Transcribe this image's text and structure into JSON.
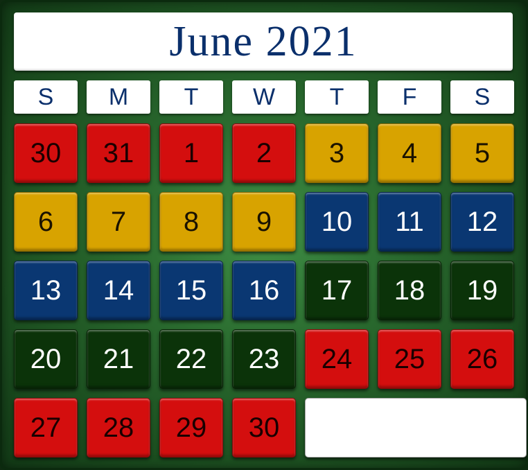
{
  "title": "June 2021",
  "weekdays": [
    "S",
    "M",
    "T",
    "W",
    "T",
    "F",
    "S"
  ],
  "colors": {
    "background": "#2a6b2f",
    "red": "#d40e0e",
    "gold": "#d8a300",
    "blue": "#0a3772",
    "green": "#0b3309",
    "title_text": "#0a2f6b"
  },
  "weeks": [
    [
      {
        "label": "30",
        "color": "red"
      },
      {
        "label": "31",
        "color": "red"
      },
      {
        "label": "1",
        "color": "red"
      },
      {
        "label": "2",
        "color": "red"
      },
      {
        "label": "3",
        "color": "gold"
      },
      {
        "label": "4",
        "color": "gold"
      },
      {
        "label": "5",
        "color": "gold"
      }
    ],
    [
      {
        "label": "6",
        "color": "gold"
      },
      {
        "label": "7",
        "color": "gold"
      },
      {
        "label": "8",
        "color": "gold"
      },
      {
        "label": "9",
        "color": "gold"
      },
      {
        "label": "10",
        "color": "blue"
      },
      {
        "label": "11",
        "color": "blue"
      },
      {
        "label": "12",
        "color": "blue"
      }
    ],
    [
      {
        "label": "13",
        "color": "blue"
      },
      {
        "label": "14",
        "color": "blue"
      },
      {
        "label": "15",
        "color": "blue"
      },
      {
        "label": "16",
        "color": "blue"
      },
      {
        "label": "17",
        "color": "green"
      },
      {
        "label": "18",
        "color": "green"
      },
      {
        "label": "19",
        "color": "green"
      }
    ],
    [
      {
        "label": "20",
        "color": "green"
      },
      {
        "label": "21",
        "color": "green"
      },
      {
        "label": "22",
        "color": "green"
      },
      {
        "label": "23",
        "color": "green"
      },
      {
        "label": "24",
        "color": "red"
      },
      {
        "label": "25",
        "color": "red"
      },
      {
        "label": "26",
        "color": "red"
      }
    ],
    [
      {
        "label": "27",
        "color": "red"
      },
      {
        "label": "28",
        "color": "red"
      },
      {
        "label": "29",
        "color": "red"
      },
      {
        "label": "30",
        "color": "red"
      }
    ]
  ]
}
